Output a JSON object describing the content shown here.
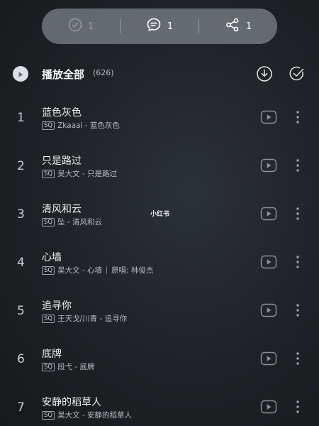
{
  "action_bar": {
    "like_count": "1",
    "comment_count": "1",
    "share_count": "1"
  },
  "header": {
    "title": "播放全部",
    "count": "(626)"
  },
  "quality_badge": "SQ",
  "songs": [
    {
      "index": "1",
      "title": "蓝色灰色",
      "subtitle": "Zkaaai - 蓝色灰色",
      "original": ""
    },
    {
      "index": "2",
      "title": "只是路过",
      "subtitle": "吴大文 - 只是路过",
      "original": ""
    },
    {
      "index": "3",
      "title": "清风和云",
      "subtitle": "坠 - 清风和云",
      "original": ""
    },
    {
      "index": "4",
      "title": "心墙",
      "subtitle": "吴大文 - 心墙",
      "original": "原唱: 林俊杰"
    },
    {
      "index": "5",
      "title": "追寻你",
      "subtitle": "王天戈/川青 - 追寻你",
      "original": ""
    },
    {
      "index": "6",
      "title": "底牌",
      "subtitle": "段弋 - 底牌",
      "original": ""
    },
    {
      "index": "7",
      "title": "安静的稻草人",
      "subtitle": "吴大文 - 安静的稻草人",
      "original": ""
    }
  ],
  "watermark": "小红书"
}
